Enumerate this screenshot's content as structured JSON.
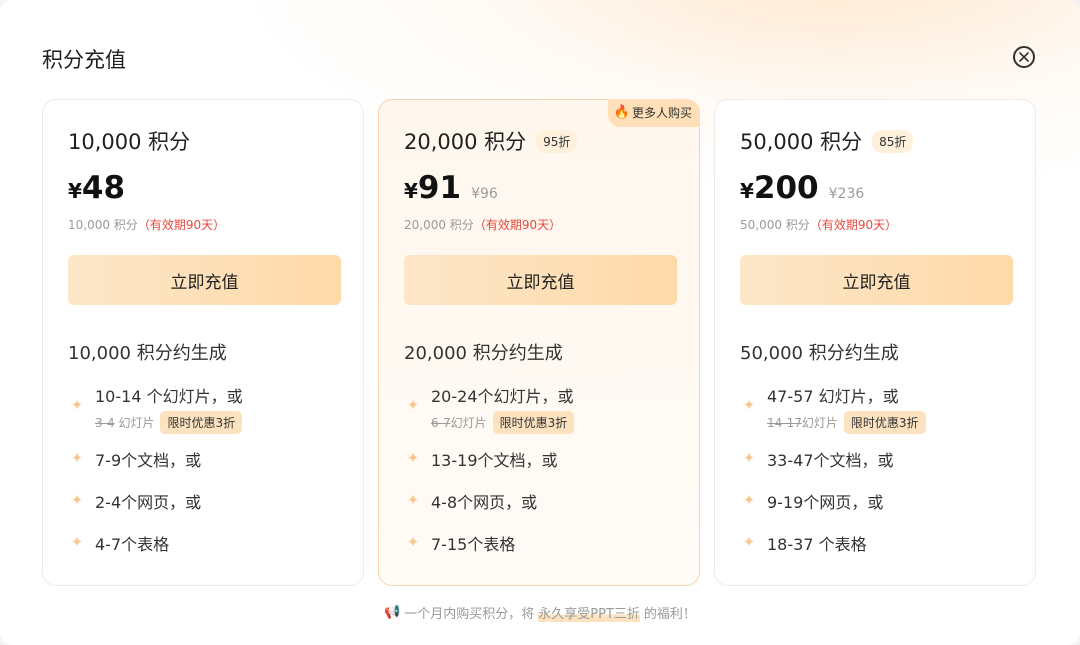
{
  "dialog": {
    "title": "积分充值"
  },
  "plans": [
    {
      "amount": "10,000 积分",
      "discount": "",
      "hot_badge": "",
      "price": "48",
      "original_price": "",
      "validity_prefix": "10,000 积分",
      "validity": "（有效期90天）",
      "buy_label": "立即充值",
      "gen_title": "10,000 积分约生成",
      "features": {
        "slides": "10-14 个幻灯片，或",
        "slides_old": "3-4",
        "slides_old_unit": "幻灯片",
        "promo": "限时优惠3折",
        "docs": "7-9个文档，或",
        "pages": "2-4个网页，或",
        "sheets": "4-7个表格"
      }
    },
    {
      "amount": "20,000 积分",
      "discount": "95折",
      "hot_badge": "更多人购买",
      "price": "91",
      "original_price": "¥96",
      "validity_prefix": "20,000 积分",
      "validity": "（有效期90天）",
      "buy_label": "立即充值",
      "gen_title": "20,000 积分约生成",
      "features": {
        "slides": "20-24个幻灯片，或",
        "slides_old": "6-7",
        "slides_old_unit": "幻灯片",
        "promo": "限时优惠3折",
        "docs": "13-19个文档，或",
        "pages": "4-8个网页，或",
        "sheets": "7-15个表格"
      }
    },
    {
      "amount": "50,000 积分",
      "discount": "85折",
      "hot_badge": "",
      "price": "200",
      "original_price": "¥236",
      "validity_prefix": "50,000 积分",
      "validity": "（有效期90天）",
      "buy_label": "立即充值",
      "gen_title": "50,000 积分约生成",
      "features": {
        "slides": "47-57 幻灯片，或",
        "slides_old": "14-17",
        "slides_old_unit": "幻灯片",
        "promo": "限时优惠3折",
        "docs": "33-47个文档，或",
        "pages": "9-19个网页，或",
        "sheets": "18-37 个表格"
      }
    }
  ],
  "currency_symbol": "¥",
  "footer": {
    "text_before": "一个月内购买积分，将",
    "text_highlight": "永久享受PPT三折",
    "text_after": "的福利！"
  },
  "icons": {
    "close": "close-icon",
    "sparkle": "sparkle-icon",
    "flame": "flame-icon",
    "megaphone": "megaphone-icon"
  },
  "colors": {
    "accent_gradient_start": "#fde7c8",
    "accent_gradient_end": "#fed9a8",
    "validity_red": "#e8473c",
    "sparkle": "#f5c98f"
  }
}
